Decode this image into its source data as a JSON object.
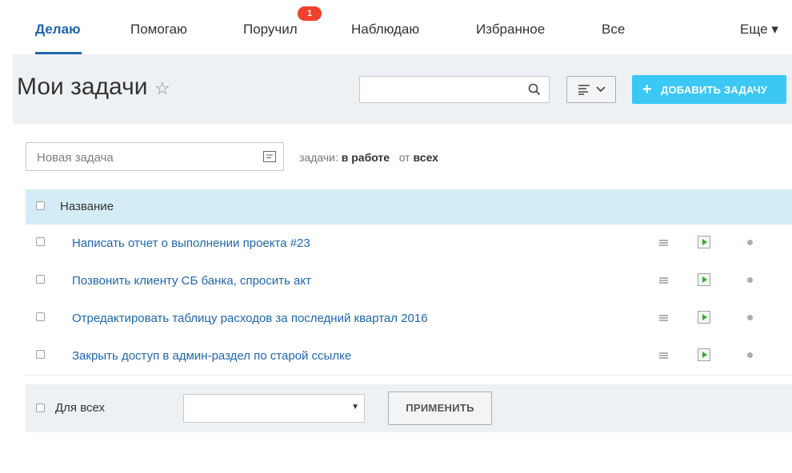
{
  "tabs": [
    {
      "label": "Делаю",
      "active": true
    },
    {
      "label": "Помогаю"
    },
    {
      "label": "Поручил",
      "badge": "1"
    },
    {
      "label": "Наблюдаю"
    },
    {
      "label": "Избранное"
    },
    {
      "label": "Все"
    },
    {
      "label": "Еще ▾"
    }
  ],
  "header": {
    "title": "Мои задачи",
    "star_icon": "star-icon",
    "search_placeholder": "",
    "add_button_label": "Добавить задачу"
  },
  "quick_add": {
    "placeholder": "Новая задача",
    "filter_prefix": "задачи:",
    "filter_status": "в работе",
    "filter_from": "от",
    "filter_whom": "всех"
  },
  "table": {
    "column_name": "Название",
    "rows": [
      {
        "title": "Написать отчет о выполнении проекта #23"
      },
      {
        "title": "Позвонить клиенту СБ банка, спросить акт"
      },
      {
        "title": "Отредактировать таблицу расходов за последний квартал 2016"
      },
      {
        "title": "Закрыть доступ в админ-раздел по старой ссылке"
      }
    ]
  },
  "footer": {
    "for_all_label": "Для всех",
    "select_value": "",
    "apply_label": "ПРИМЕНИТЬ"
  },
  "colors": {
    "accent": "#2067b0",
    "add_button": "#3bc8f5",
    "badge": "#f0412c",
    "table_header": "#d4ecf5"
  }
}
